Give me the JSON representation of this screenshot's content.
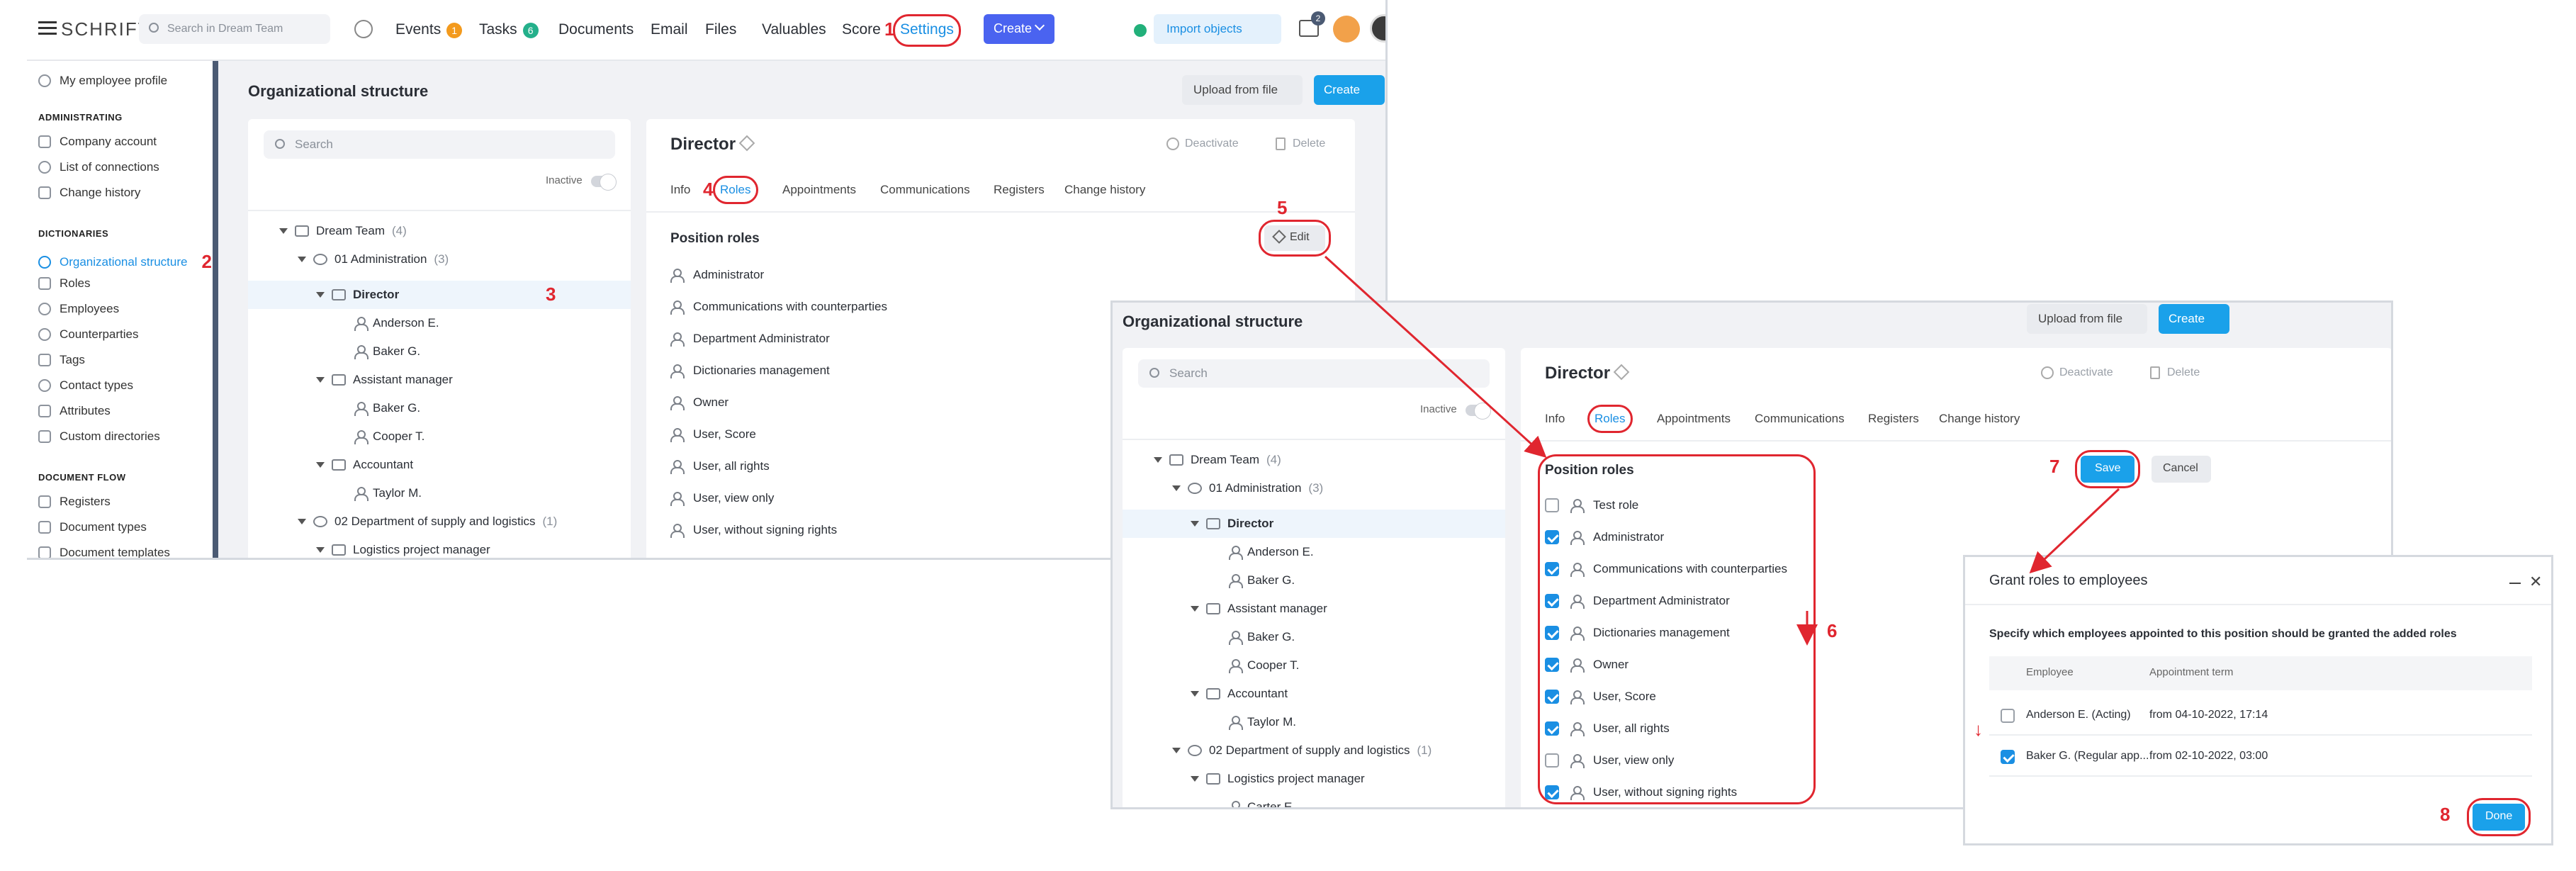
{
  "shot1": {
    "logo": "SCHRIFT",
    "search_placeholder": "Search in Dream Team",
    "nav": {
      "events": "Events",
      "events_count": "1",
      "tasks": "Tasks",
      "tasks_count": "6",
      "documents": "Documents",
      "email": "Email",
      "files": "Files",
      "valuables": "Valuables",
      "score": "Score",
      "settings": "Settings",
      "create": "Create",
      "import": "Import objects",
      "notif_count": "2"
    },
    "sidebar": {
      "profile": "My employee profile",
      "sec_admin": "ADMINISTRATING",
      "company": "Company account",
      "connections": "List of connections",
      "history": "Change history",
      "sec_dict": "DICTIONARIES",
      "org": "Organizational structure",
      "roles": "Roles",
      "employees": "Employees",
      "counterparties": "Counterparties",
      "tags": "Tags",
      "contact_types": "Contact types",
      "attributes": "Attributes",
      "custom": "Custom directories",
      "sec_doc": "DOCUMENT FLOW",
      "registers": "Registers",
      "doc_types": "Document types",
      "doc_templates": "Document templates"
    },
    "page_title": "Organizational structure",
    "upload": "Upload from file",
    "create": "Create",
    "tree_search": "Search",
    "inactive": "Inactive",
    "tree": {
      "root": "Dream Team",
      "root_count": "(4)",
      "admin": "01 Administration",
      "admin_count": "(3)",
      "director": "Director",
      "anderson": "Anderson E.",
      "baker": "Baker G.",
      "asst": "Assistant manager",
      "baker2": "Baker G.",
      "cooper": "Cooper T.",
      "accountant": "Accountant",
      "taylor": "Taylor M.",
      "dept2": "02 Department of supply and logistics",
      "dept2_count": "(1)",
      "logistics": "Logistics project manager"
    },
    "detail_title": "Director",
    "deactivate": "Deactivate",
    "delete": "Delete",
    "tabs": {
      "info": "Info",
      "roles": "Roles",
      "appointments": "Appointments",
      "communications": "Communications",
      "registers": "Registers",
      "history": "Change history"
    },
    "position_roles": "Position roles",
    "edit": "Edit",
    "roles_list": [
      "Administrator",
      "Communications with counterparties",
      "Department Administrator",
      "Dictionaries management",
      "Owner",
      "User, Score",
      "User, all rights",
      "User, view only",
      "User, without signing rights"
    ],
    "markers": {
      "m1": "1",
      "m2": "2",
      "m3": "3",
      "m4": "4",
      "m5": "5"
    }
  },
  "shot2": {
    "page_title": "Organizational structure",
    "upload": "Upload from file",
    "create": "Create",
    "tree_search": "Search",
    "inactive": "Inactive",
    "tree": {
      "root": "Dream Team",
      "root_count": "(4)",
      "admin": "01 Administration",
      "admin_count": "(3)",
      "director": "Director",
      "anderson": "Anderson E.",
      "baker": "Baker G.",
      "asst": "Assistant manager",
      "baker2": "Baker G.",
      "cooper": "Cooper T.",
      "accountant": "Accountant",
      "taylor": "Taylor M.",
      "dept2": "02 Department of supply and logistics",
      "dept2_count": "(1)",
      "logistics": "Logistics project manager",
      "carter": "Carter E."
    },
    "detail_title": "Director",
    "deactivate": "Deactivate",
    "delete": "Delete",
    "tabs": {
      "info": "Info",
      "roles": "Roles",
      "appointments": "Appointments",
      "communications": "Communications",
      "registers": "Registers",
      "history": "Change history"
    },
    "position_roles": "Position roles",
    "save": "Save",
    "cancel": "Cancel",
    "roles_list": [
      {
        "label": "Test role",
        "checked": false
      },
      {
        "label": "Administrator",
        "checked": true
      },
      {
        "label": "Communications with counterparties",
        "checked": true
      },
      {
        "label": "Department Administrator",
        "checked": true
      },
      {
        "label": "Dictionaries management",
        "checked": true
      },
      {
        "label": "Owner",
        "checked": true
      },
      {
        "label": "User, Score",
        "checked": true
      },
      {
        "label": "User, all rights",
        "checked": true
      },
      {
        "label": "User, view only",
        "checked": false
      },
      {
        "label": "User, without signing rights",
        "checked": true
      }
    ],
    "markers": {
      "m6": "6",
      "m7": "7"
    }
  },
  "dialog": {
    "title": "Grant roles to employees",
    "description": "Specify which employees appointed to this position should be granted the added roles",
    "col_employee": "Employee",
    "col_term": "Appointment term",
    "rows": [
      {
        "employee": "Anderson E. (Acting)",
        "term": "from 04-10-2022, 17:14",
        "checked": false
      },
      {
        "employee": "Baker G. (Regular app...",
        "term": "from 02-10-2022, 03:00",
        "checked": true
      }
    ],
    "done": "Done",
    "marker": "8"
  },
  "colors": {
    "accent": "#1aa1ea",
    "primary": "#4a63f0",
    "annotation": "#e0262f",
    "sidebar_active": "#1a8fe3"
  }
}
